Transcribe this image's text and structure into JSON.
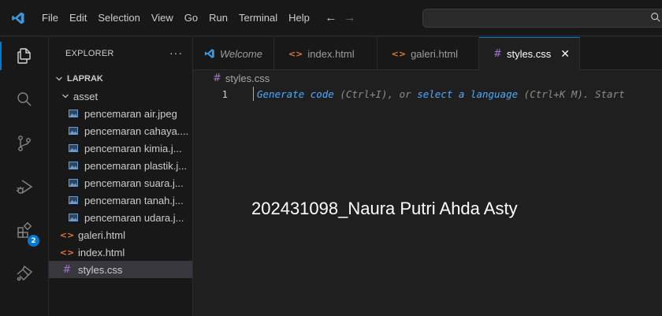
{
  "menu": {
    "items": [
      "File",
      "Edit",
      "Selection",
      "View",
      "Go",
      "Run",
      "Terminal",
      "Help"
    ]
  },
  "nav": {
    "back": "←",
    "forward": "→"
  },
  "explorer": {
    "header": "EXPLORER",
    "more": "···",
    "root": "LAPRAK",
    "folder": "asset",
    "assets": [
      "pencemaran air.jpeg",
      "pencemaran cahaya....",
      "pencemaran kimia.j...",
      "pencemaran plastik.j...",
      "pencemaran suara.j...",
      "pencemaran tanah.j...",
      "pencemaran udara.j..."
    ],
    "files": {
      "galeri": "galeri.html",
      "index": "index.html",
      "styles": "styles.css"
    }
  },
  "activity": {
    "extensions_badge": "2"
  },
  "tabs": {
    "welcome": "Welcome",
    "index": "index.html",
    "galeri": "galeri.html",
    "styles": "styles.css",
    "close": "✕"
  },
  "breadcrumb": {
    "file": "styles.css"
  },
  "editor": {
    "line_number": "1",
    "hint": {
      "generate": "Generate code",
      "part1": " (Ctrl+I), or ",
      "select": "select a language",
      "part2": " (Ctrl+K M). Start"
    },
    "watermark": "202431098_Naura Putri Ahda Asty"
  },
  "colors": {
    "accent": "#0078d4",
    "vscode_blue": "#3a96dd",
    "html_icon": "#e37933",
    "css_icon": "#a074c4",
    "image_icon": "#6b9bd2"
  }
}
